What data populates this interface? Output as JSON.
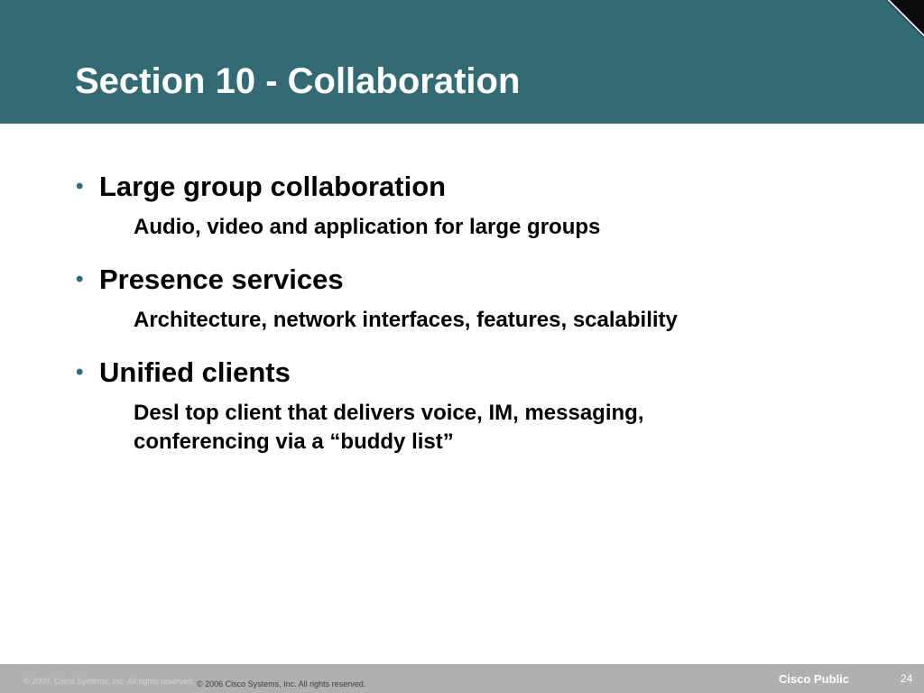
{
  "slide": {
    "title": "Section 10 - Collaboration",
    "bullet_symbol": "•",
    "bullets": [
      {
        "heading": "Large group collaboration",
        "detail": "Audio, video and application for large groups"
      },
      {
        "heading": "Presence services",
        "detail": "Architecture, network interfaces, features, scalability"
      },
      {
        "heading": "Unified clients",
        "detail": "Desl top client that delivers voice, IM, messaging, conferencing via a “buddy list”"
      }
    ]
  },
  "footer": {
    "ghost_copyright": "© 2003, Cisco Systems, Inc. All rights reserved.",
    "copyright": "© 2006 Cisco Systems, Inc. All rights reserved.",
    "classification": "Cisco Public",
    "page_number": "24"
  },
  "colors": {
    "header_bg": "#336b75",
    "footer_bg": "#b0b0b0",
    "bullet_dot": "#336b75"
  }
}
